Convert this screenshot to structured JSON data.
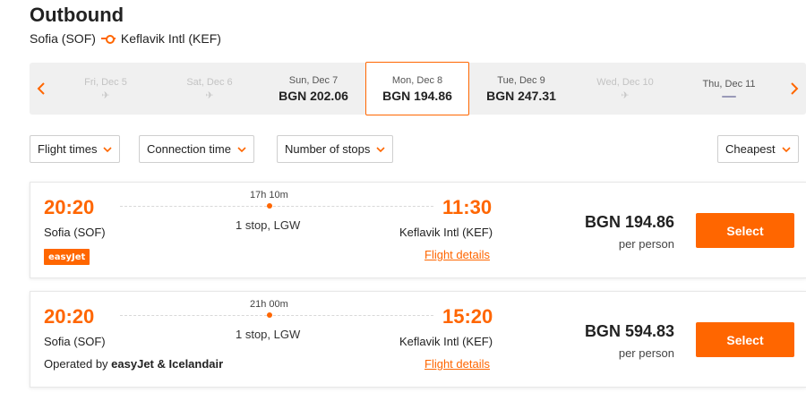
{
  "header": {
    "title": "Outbound",
    "origin": "Sofia (SOF)",
    "destination": "Keflavik Intl (KEF)"
  },
  "date_strip": {
    "dates": [
      {
        "label": "Fri, Dec 5",
        "price": "",
        "state": "disabled"
      },
      {
        "label": "Sat, Dec 6",
        "price": "",
        "state": "disabled"
      },
      {
        "label": "Sun, Dec 7",
        "price": "BGN 202.06",
        "state": "available"
      },
      {
        "label": "Mon, Dec 8",
        "price": "BGN 194.86",
        "state": "selected"
      },
      {
        "label": "Tue, Dec 9",
        "price": "BGN 247.31",
        "state": "available"
      },
      {
        "label": "Wed, Dec 10",
        "price": "",
        "state": "disabled"
      },
      {
        "label": "Thu, Dec 11",
        "price": "",
        "state": "loading"
      }
    ]
  },
  "filters": {
    "flight_times": "Flight times",
    "connection_time": "Connection time",
    "number_of_stops": "Number of stops",
    "sort": "Cheapest"
  },
  "flights": [
    {
      "departure_time": "20:20",
      "arrival_time": "11:30",
      "duration": "17h 10m",
      "stops": "1 stop, LGW",
      "departure_airport": "Sofia (SOF)",
      "arrival_airport": "Keflavik Intl (KEF)",
      "details_label": "Flight details",
      "airline_logo_text": "easyJet",
      "price": "BGN 194.86",
      "per_person": "per person",
      "select_label": "Select"
    },
    {
      "departure_time": "20:20",
      "arrival_time": "15:20",
      "duration": "21h 00m",
      "stops": "1 stop, LGW",
      "departure_airport": "Sofia (SOF)",
      "arrival_airport": "Keflavik Intl (KEF)",
      "details_label": "Flight details",
      "operated_prefix": "Operated by",
      "operated_by": "easyJet & Icelandair",
      "price": "BGN 594.83",
      "per_person": "per person",
      "select_label": "Select"
    }
  ],
  "colors": {
    "accent": "#ff6600",
    "strip_bg": "#f0f0f0",
    "disabled_text": "#c3c3c3"
  }
}
